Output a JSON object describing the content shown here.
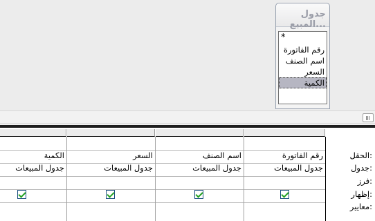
{
  "table_box": {
    "title": "جدول المبيع...",
    "fields": [
      {
        "label": "*",
        "selected": false
      },
      {
        "label": "رقم الفاتورة",
        "selected": false
      },
      {
        "label": "اسم الصنف",
        "selected": false
      },
      {
        "label": "السعر",
        "selected": false
      },
      {
        "label": "الكمية",
        "selected": true
      }
    ]
  },
  "grid": {
    "row_labels": {
      "field": "الحقل:",
      "table": "جدول:",
      "sort": "فرز:",
      "show": "إظهار:",
      "criteria": "معايير:"
    },
    "columns": [
      {
        "field": "رقم الفاتورة",
        "table": "جدول المبيعات",
        "show": true
      },
      {
        "field": "اسم الصنف",
        "table": "جدول المبيعات",
        "show": true
      },
      {
        "field": "السعر",
        "table": "جدول المبيعات",
        "show": true
      },
      {
        "field": "الكمية",
        "table": "جدول المبيعات",
        "show": true
      }
    ]
  },
  "colors": {
    "title_text": "#9a9da8",
    "selection": "#b6b6c2",
    "checkmark": "#21a121"
  }
}
